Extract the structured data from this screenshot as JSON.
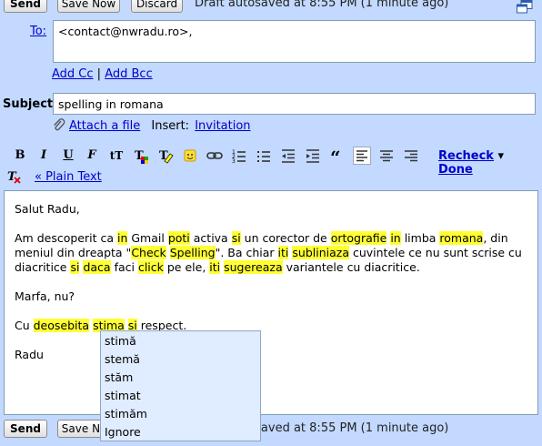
{
  "top_bar": {
    "send_label": "Send",
    "save_now_label": "Save Now",
    "discard_label": "Discard",
    "status": "Draft autosaved at 8:55 PM (1 minute ago)",
    "popout_icon": "new-window-icon"
  },
  "bottom_bar": {
    "send_label": "Send",
    "save_now_label": "Save Now",
    "status": "Draft autosaved at 8:55 PM (1 minute ago)"
  },
  "to": {
    "label": "To:",
    "value": "<contact@nwradu.ro>,"
  },
  "cc_links": {
    "add_cc": "Add Cc",
    "separator": "|",
    "add_bcc": "Add Bcc"
  },
  "subject": {
    "label": "Subject:",
    "value": "spelling in romana"
  },
  "attach": {
    "attach_label": "Attach a file",
    "insert_label": "Insert:",
    "invitation_label": "Invitation"
  },
  "toolbar": {
    "bold": "B",
    "italic": "I",
    "underline": "U",
    "font": "F",
    "size": "tT",
    "recheck_label": "Recheck",
    "recheck_arrow": "▾",
    "done_label": "Done",
    "plain_text_label": "« Plain Text"
  },
  "body": {
    "greeting": "Salut Radu,",
    "p1": [
      {
        "t": "Am descoperit ca ",
        "h": false
      },
      {
        "t": "in",
        "h": true
      },
      {
        "t": " Gmail ",
        "h": false
      },
      {
        "t": "poti",
        "h": true
      },
      {
        "t": " activa ",
        "h": false
      },
      {
        "t": "si",
        "h": true
      },
      {
        "t": " un corector de ",
        "h": false
      },
      {
        "t": "ortografie",
        "h": true
      },
      {
        "t": " ",
        "h": false
      },
      {
        "t": "in",
        "h": true
      },
      {
        "t": " limba ",
        "h": false
      },
      {
        "t": "romana",
        "h": true
      },
      {
        "t": ", din meniul din dreapta \"",
        "h": false
      },
      {
        "t": "Check",
        "h": true
      },
      {
        "t": " ",
        "h": false
      },
      {
        "t": "Spelling",
        "h": true
      },
      {
        "t": "\". Ba chiar ",
        "h": false
      },
      {
        "t": "iti",
        "h": true
      },
      {
        "t": " ",
        "h": false
      },
      {
        "t": "subliniaza",
        "h": true
      },
      {
        "t": " cuvintele ce nu sunt scrise cu diacritice ",
        "h": false
      },
      {
        "t": "si",
        "h": true
      },
      {
        "t": " ",
        "h": false
      },
      {
        "t": "daca",
        "h": true
      },
      {
        "t": " faci ",
        "h": false
      },
      {
        "t": "click",
        "h": true
      },
      {
        "t": " pe ele, ",
        "h": false
      },
      {
        "t": "iti",
        "h": true
      },
      {
        "t": " ",
        "h": false
      },
      {
        "t": "sugereaza",
        "h": true
      },
      {
        "t": " variantele cu diacritice.",
        "h": false
      }
    ],
    "p2": "Marfa, nu?",
    "p3": [
      {
        "t": "Cu ",
        "h": false
      },
      {
        "t": "deosebita",
        "h": true
      },
      {
        "t": " ",
        "h": false
      },
      {
        "t": "stima",
        "h": true
      },
      {
        "t": " ",
        "h": false
      },
      {
        "t": "si",
        "h": true
      },
      {
        "t": " respect.",
        "h": false
      }
    ],
    "signature": "Radu"
  },
  "suggestions": [
    "stimă",
    "stemă",
    "stăm",
    "stimat",
    "stimăm",
    "Ignore"
  ],
  "colors": {
    "background": "#c3d9ff",
    "link": "#0000cc",
    "highlight": "#ffff33",
    "menu_bg": "#e0ecff"
  }
}
